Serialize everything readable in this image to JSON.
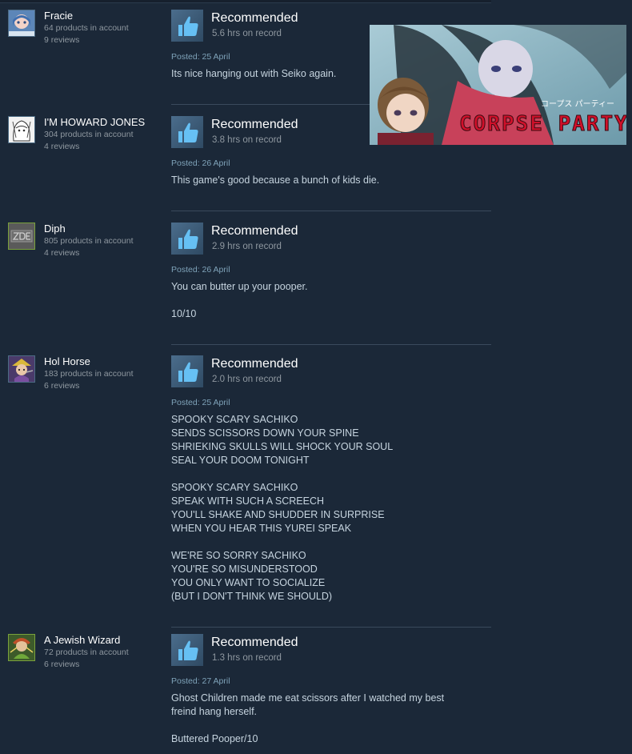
{
  "reviews": [
    {
      "author": "Fracie",
      "products": "64 products in account",
      "reviews_count": "9 reviews",
      "verdict": "Recommended",
      "hours": "5.6 hrs on record",
      "posted": "Posted: 25 April",
      "lines": [
        "Its nice hanging out with Seiko again."
      ]
    },
    {
      "author": "I'M HOWARD JONES",
      "products": "304 products in account",
      "reviews_count": "4 reviews",
      "verdict": "Recommended",
      "hours": "3.8 hrs on record",
      "posted": "Posted: 26 April",
      "lines": [
        "This game's good because a bunch of kids die."
      ]
    },
    {
      "author": "Diph",
      "products": "805 products in account",
      "reviews_count": "4 reviews",
      "verdict": "Recommended",
      "hours": "2.9 hrs on record",
      "posted": "Posted: 26 April",
      "lines": [
        "You can butter up your pooper.",
        "",
        "10/10"
      ]
    },
    {
      "author": "Hol Horse",
      "products": "183 products in account",
      "reviews_count": "6 reviews",
      "verdict": "Recommended",
      "hours": "2.0 hrs on record",
      "posted": "Posted: 25 April",
      "lines": [
        "SPOOKY SCARY SACHIKO",
        "SENDS SCISSORS DOWN YOUR SPINE",
        "SHRIEKING SKULLS WILL SHOCK YOUR SOUL",
        "SEAL YOUR DOOM TONIGHT",
        "",
        "SPOOKY SCARY SACHIKO",
        "SPEAK WITH SUCH A SCREECH",
        "YOU'LL SHAKE AND SHUDDER IN SURPRISE",
        "WHEN YOU HEAR THIS YUREI SPEAK",
        "",
        "WE'RE SO SORRY SACHIKO",
        "YOU'RE SO MISUNDERSTOOD",
        "YOU ONLY WANT TO SOCIALIZE",
        "(BUT I DON'T THINK WE SHOULD)"
      ]
    },
    {
      "author": "A Jewish Wizard",
      "products": "72 products in account",
      "reviews_count": "6 reviews",
      "verdict": "Recommended",
      "hours": "1.3 hrs on record",
      "posted": "Posted: 27 April",
      "lines": [
        "Ghost Children made me eat scissors after I watched my best",
        "freind hang herself.",
        "",
        "Buttered Pooper/10"
      ]
    }
  ],
  "banner": {
    "title": "CORPSE PARTY",
    "subtitle": "コープス パーティー"
  },
  "colors": {
    "background": "#1b2838",
    "recommended_thumb": "#66c0f4",
    "posted": "#7fa3b9"
  }
}
